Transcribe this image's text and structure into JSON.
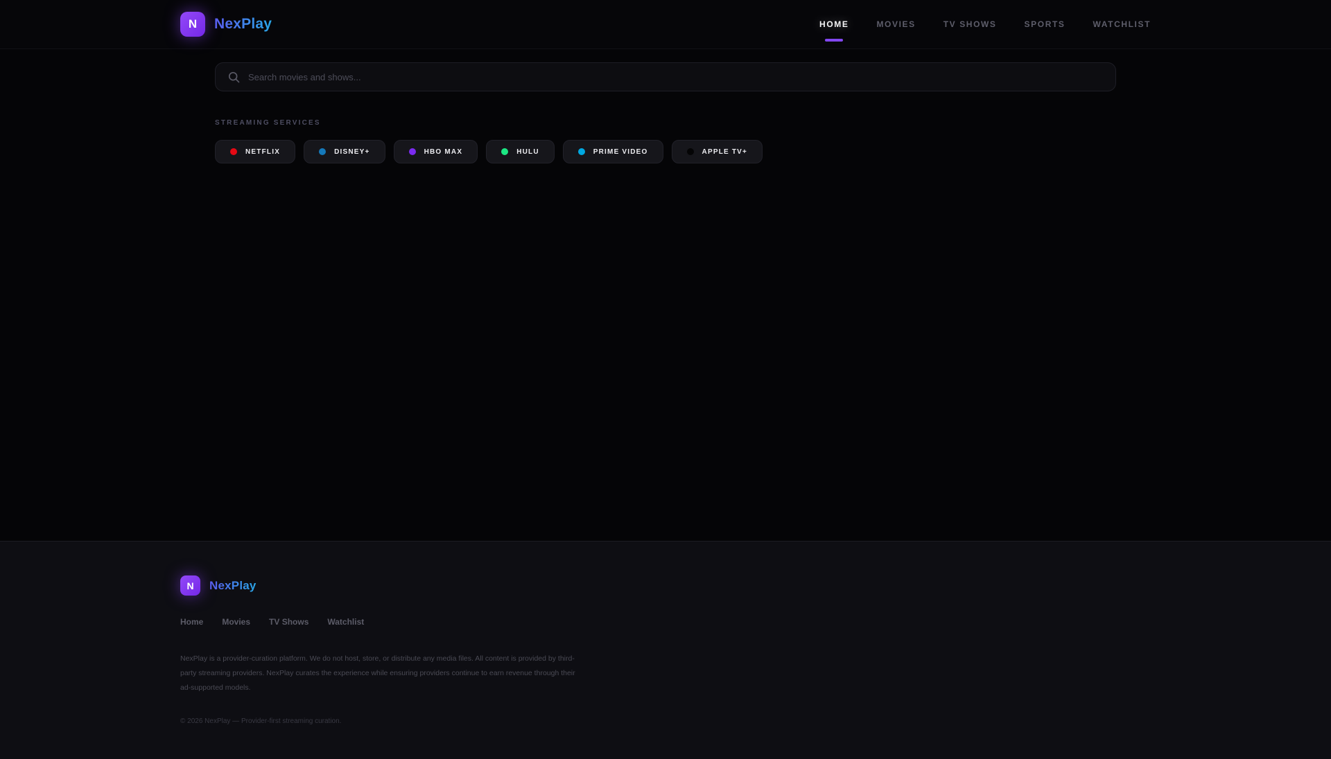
{
  "brand": {
    "name": "NexPlay",
    "logo_letter": "N",
    "accent_color": "#8247f0",
    "logo_gradient": [
      "#9349f8",
      "#7428e8"
    ],
    "name_gradient": [
      "#5a5cee",
      "#29a7e8"
    ]
  },
  "nav": {
    "items": [
      {
        "label": "HOME",
        "active": true
      },
      {
        "label": "MOVIES",
        "active": false
      },
      {
        "label": "TV SHOWS",
        "active": false
      },
      {
        "label": "SPORTS",
        "active": false
      },
      {
        "label": "WATCHLIST",
        "active": false
      }
    ]
  },
  "search": {
    "placeholder": "Search movies and shows...",
    "value": ""
  },
  "services": {
    "heading": "STREAMING SERVICES",
    "items": [
      {
        "label": "NETFLIX",
        "color": "#e50914"
      },
      {
        "label": "DISNEY+",
        "color": "#1579ba"
      },
      {
        "label": "HBO MAX",
        "color": "#7b2bf0"
      },
      {
        "label": "HULU",
        "color": "#1ce783"
      },
      {
        "label": "PRIME VIDEO",
        "color": "#00a8e1"
      },
      {
        "label": "APPLE TV+",
        "color": "#040405"
      }
    ]
  },
  "footer": {
    "links": [
      {
        "label": "Home"
      },
      {
        "label": "Movies"
      },
      {
        "label": "TV Shows"
      },
      {
        "label": "Watchlist"
      }
    ],
    "disclaimer": "NexPlay is a provider-curation platform. We do not host, store, or distribute any media files. All content is provided by third-party streaming providers. NexPlay curates the experience while ensuring providers continue to earn revenue through their ad-supported models.",
    "copyright": "© 2026 NexPlay — Provider-first streaming curation."
  }
}
